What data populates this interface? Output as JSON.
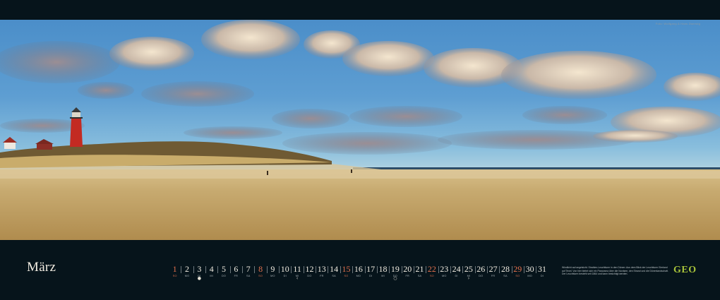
{
  "credit": "Foto: Wolfgang & Hans Zwerwig",
  "calendar": {
    "month": "März",
    "days": [
      {
        "n": "1",
        "wd": "SO",
        "sunday": true
      },
      {
        "n": "2",
        "wd": "MO"
      },
      {
        "n": "3",
        "wd": "DI",
        "mark": "●"
      },
      {
        "n": "4",
        "wd": "MI"
      },
      {
        "n": "5",
        "wd": "DO"
      },
      {
        "n": "6",
        "wd": "FR"
      },
      {
        "n": "7",
        "wd": "SA"
      },
      {
        "n": "8",
        "wd": "SO",
        "sunday": true
      },
      {
        "n": "9",
        "wd": "MO"
      },
      {
        "n": "10",
        "wd": "DI"
      },
      {
        "n": "11",
        "wd": "MI",
        "mark": "‹"
      },
      {
        "n": "12",
        "wd": "DO"
      },
      {
        "n": "13",
        "wd": "FR"
      },
      {
        "n": "14",
        "wd": "SA"
      },
      {
        "n": "15",
        "wd": "SO",
        "sunday": true
      },
      {
        "n": "16",
        "wd": "MO"
      },
      {
        "n": "17",
        "wd": "DI"
      },
      {
        "n": "18",
        "wd": "MI"
      },
      {
        "n": "19",
        "wd": "DO",
        "mark": "○"
      },
      {
        "n": "20",
        "wd": "FR"
      },
      {
        "n": "21",
        "wd": "SA"
      },
      {
        "n": "22",
        "wd": "SO",
        "sunday": true
      },
      {
        "n": "23",
        "wd": "MO"
      },
      {
        "n": "24",
        "wd": "DI"
      },
      {
        "n": "25",
        "wd": "MI",
        "mark": "›"
      },
      {
        "n": "26",
        "wd": "DO"
      },
      {
        "n": "27",
        "wd": "FR"
      },
      {
        "n": "28",
        "wd": "SA"
      },
      {
        "n": "29",
        "wd": "SO",
        "sunday": true
      },
      {
        "n": "30",
        "wd": "MO"
      },
      {
        "n": "31",
        "wd": "DI"
      }
    ]
  },
  "caption": "Windlicht auf angelsicht: Strahlen-Leuchtturm in den Dünen: Aus dem Blick der Leuchtturm Eierland auf Texel. Von hier bietet sich ein Panorama über die Nordsee, den Strand und die Dünenlandschaft. Der Leuchtturm besteht seit 1864 und kann besichtigt werden.",
  "logo": "GEO",
  "colors": {
    "background": "#06141b",
    "sunday": "#e4714d",
    "logo": "#a7c23a",
    "lighthouse": "#c32a22"
  }
}
